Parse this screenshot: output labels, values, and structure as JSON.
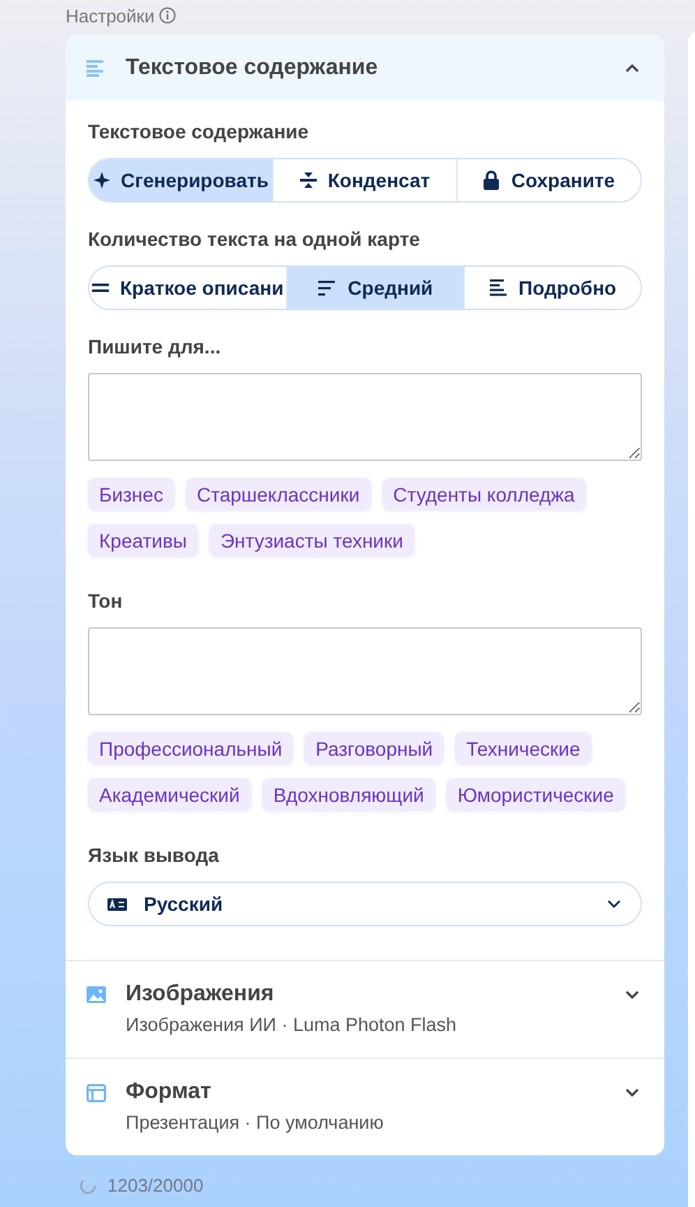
{
  "header": {
    "title": "Настройки"
  },
  "text_section": {
    "title": "Текстовое содержание",
    "expanded": true,
    "mode": {
      "label": "Текстовое содержание",
      "options": [
        {
          "label": "Сгенерировать",
          "selected": true
        },
        {
          "label": "Конденсат",
          "selected": false
        },
        {
          "label": "Сохраните",
          "selected": false
        }
      ]
    },
    "amount": {
      "label": "Количество текста на одной карте",
      "options": [
        {
          "label": "Краткое описани",
          "selected": false
        },
        {
          "label": "Средний",
          "selected": true
        },
        {
          "label": "Подробно",
          "selected": false
        }
      ]
    },
    "audience": {
      "label": "Пишите для...",
      "chips": [
        "Бизнес",
        "Старшеклассники",
        "Студенты колледжа",
        "Креативы",
        "Энтузиасты техники"
      ]
    },
    "tone": {
      "label": "Тон",
      "chips": [
        "Профессиональный",
        "Разговорный",
        "Технические",
        "Академический",
        "Вдохновляющий",
        "Юмористические"
      ]
    },
    "language": {
      "label": "Язык вывода",
      "value": "Русский"
    }
  },
  "collapsed_sections": [
    {
      "title": "Изображения",
      "subtitle": "Изображения ИИ · Luma Photon Flash",
      "expanded": false
    },
    {
      "title": "Формат",
      "subtitle": "Презентация · По умолчанию",
      "expanded": false
    }
  ],
  "footer": {
    "count": "1203/20000"
  }
}
